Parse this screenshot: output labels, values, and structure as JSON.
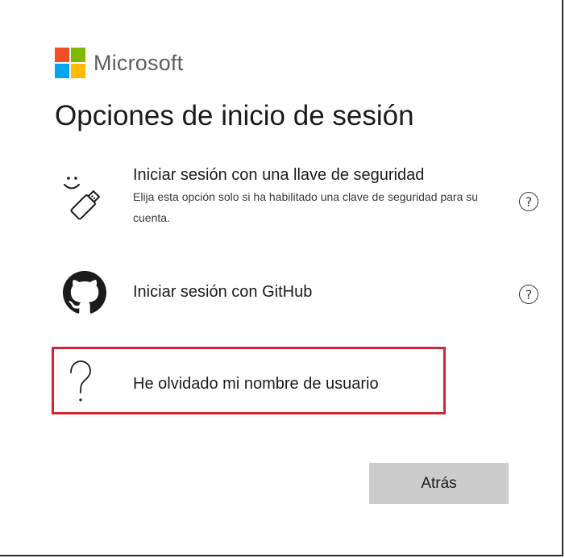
{
  "brand": {
    "name": "Microsoft",
    "logo_colors": [
      "#f25022",
      "#7fba00",
      "#00a4ef",
      "#ffb900"
    ]
  },
  "title": "Opciones de inicio de sesión",
  "options": [
    {
      "icon": "security-key-icon",
      "label": "Iniciar sesión con una llave de seguridad",
      "description": "Elija esta opción solo si ha habilitado una clave de seguridad para su cuenta.",
      "help": "?"
    },
    {
      "icon": "github-icon",
      "label": "Iniciar sesión con GitHub",
      "help": "?"
    },
    {
      "icon": "question-mark-icon",
      "label": "He olvidado mi nombre de usuario",
      "highlighted": true,
      "highlight_color": "#cf2735"
    }
  ],
  "back_button": {
    "label": "Atrás"
  }
}
